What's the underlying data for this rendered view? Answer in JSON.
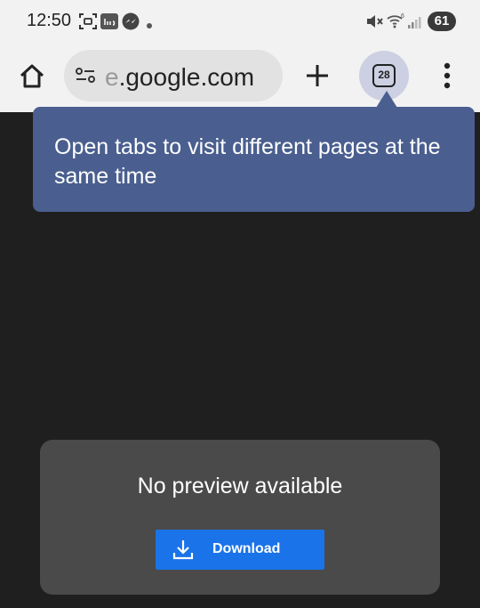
{
  "status_bar": {
    "time": "12:50",
    "battery": "61",
    "icons": [
      "screenshot-icon",
      "ring-app-icon",
      "messenger-icon",
      "notification-dot-icon",
      "mute-icon",
      "wifi-icon",
      "signal-icon",
      "battery-icon"
    ]
  },
  "toolbar": {
    "url_faded": "e",
    "url": ".google.com",
    "tab_count": "28",
    "icons": [
      "home-icon",
      "site-settings-icon",
      "plus-icon",
      "tab-switcher-icon",
      "more-vert-icon"
    ]
  },
  "tooltip": {
    "text": "Open tabs to visit different pages at the same time"
  },
  "preview": {
    "message": "No preview available",
    "download_label": "Download",
    "button_color": "#1a73e8"
  },
  "colors": {
    "page_background": "#1f1f1f",
    "tooltip_background": "#4a5f8f",
    "card_background": "#4a4a4b"
  }
}
